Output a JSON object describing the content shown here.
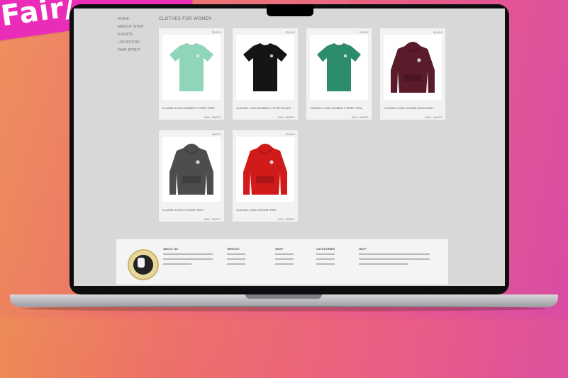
{
  "banner": {
    "text": "Fair/"
  },
  "nav": {
    "items": [
      "HOME",
      "MERCH SHOP",
      "EVENTS",
      "LOCATIONS",
      "FAIR SPIRIT"
    ]
  },
  "breadcrumb": "CLOTHES FOR WOMEN",
  "products": [
    {
      "name": "CLASSIC LOGO WOMEN T-SHIRT MINT",
      "price": "25,00 €",
      "color": "#8fd6b8",
      "type": "tee",
      "sub": "INKL. MWST."
    },
    {
      "name": "CLASSIC LOGO WOMEN T-SHIRT BLACK",
      "price": "25,00 €",
      "color": "#151515",
      "type": "tee",
      "sub": "INKL. MWST."
    },
    {
      "name": "CLASSIC LOGO WOMEN T-SHIRT TEAL",
      "price": "25,00 €",
      "color": "#2d8c6c",
      "type": "tee",
      "sub": "INKL. MWST."
    },
    {
      "name": "CLASSIC LOGO HOODIE BURGUNDY",
      "price": "45,00 €",
      "color": "#5a1c2a",
      "type": "hoodie",
      "sub": "INKL. MWST."
    },
    {
      "name": "CLASSIC LOGO HOODIE GREY",
      "price": "45,00 €",
      "color": "#4d4d4d",
      "type": "hoodie",
      "sub": "INKL. MWST."
    },
    {
      "name": "CLASSIC LOGO HOODIE RED",
      "price": "45,00 €",
      "color": "#d11b1b",
      "type": "hoodie",
      "sub": "INKL. MWST."
    }
  ],
  "footer": {
    "about": "ABOUT US",
    "cols": [
      "SERVICE",
      "SHOP",
      "CATEGORIES",
      "HELP"
    ]
  }
}
